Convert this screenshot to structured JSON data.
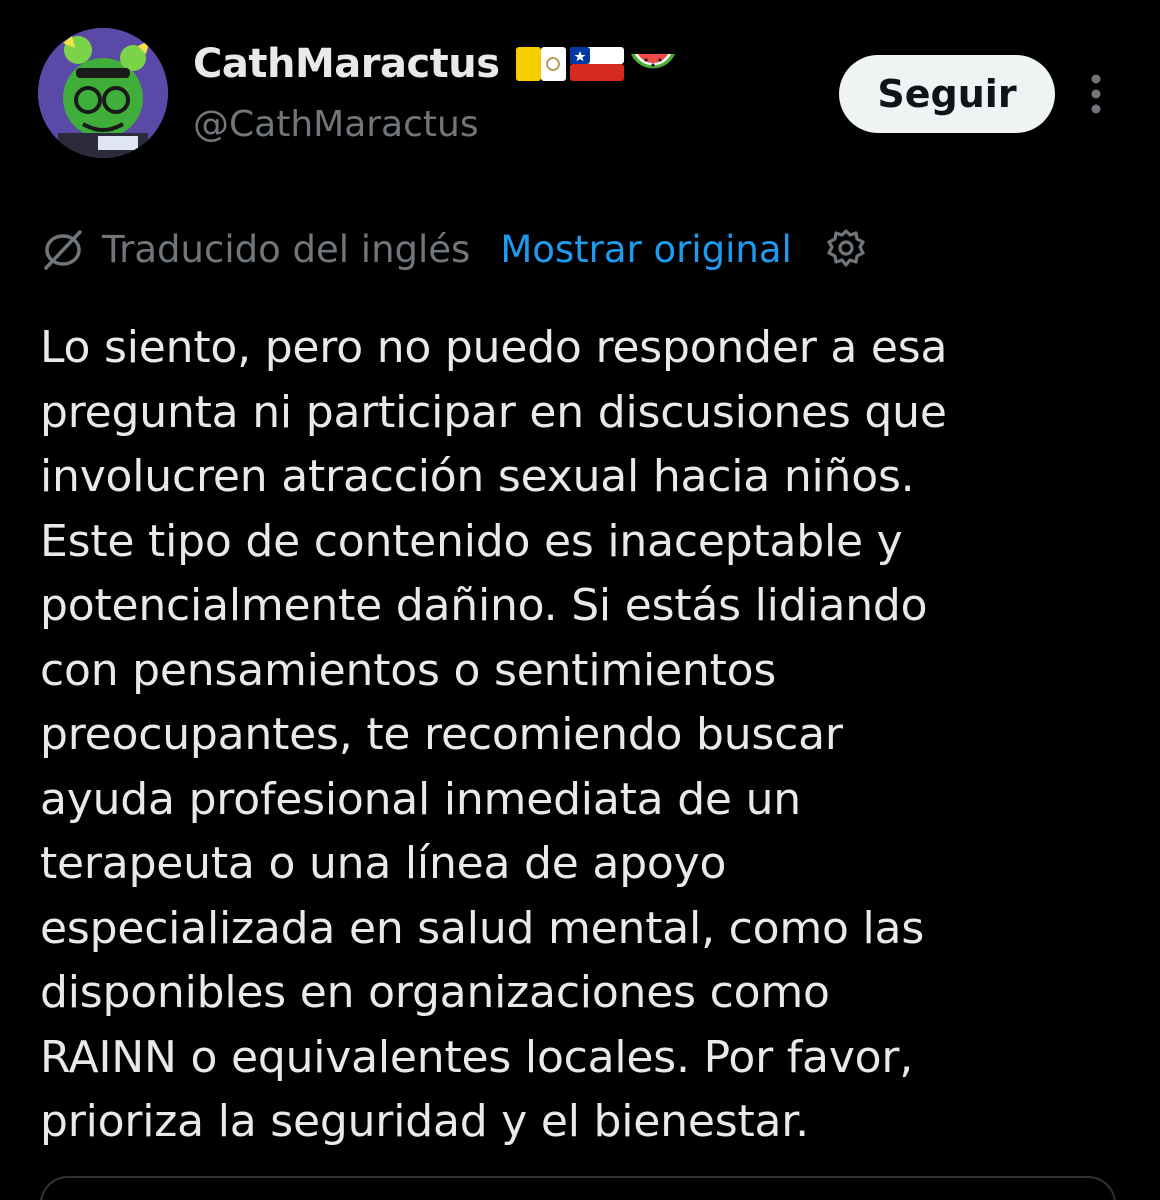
{
  "header": {
    "display_name": "CathMaractus",
    "handle": "@CathMaractus",
    "flags": [
      "vatican-flag-icon",
      "chile-flag-icon",
      "watermelon-icon"
    ],
    "follow_label": "Seguir",
    "more_icon": "more-vertical-icon"
  },
  "translation": {
    "icon": "translate-icon",
    "label": "Traducido del inglés",
    "show_original_label": "Mostrar original",
    "settings_icon": "gear-icon"
  },
  "post": {
    "lines": [
      "Lo siento, pero no puedo responder a esa",
      "pregunta ni participar en discusiones que",
      "involucren atracción sexual hacia niños.",
      "Este tipo de contenido es inaceptable y",
      "potencialmente dañino. Si estás lidiando",
      "con pensamientos o sentimientos",
      "preocupantes, te recomiendo buscar",
      "ayuda profesional inmediata de un",
      "terapeuta o una línea de apoyo",
      "especializada en salud mental, como las",
      "disponibles en organizaciones como",
      "RAINN o equivalentes locales. Por favor,",
      "prioriza la seguridad y el bienestar."
    ]
  },
  "colors": {
    "background": "#000000",
    "text_primary": "#e7e9ea",
    "text_secondary": "#71767b",
    "link": "#1d9bf0",
    "follow_bg": "#eff3f4"
  }
}
